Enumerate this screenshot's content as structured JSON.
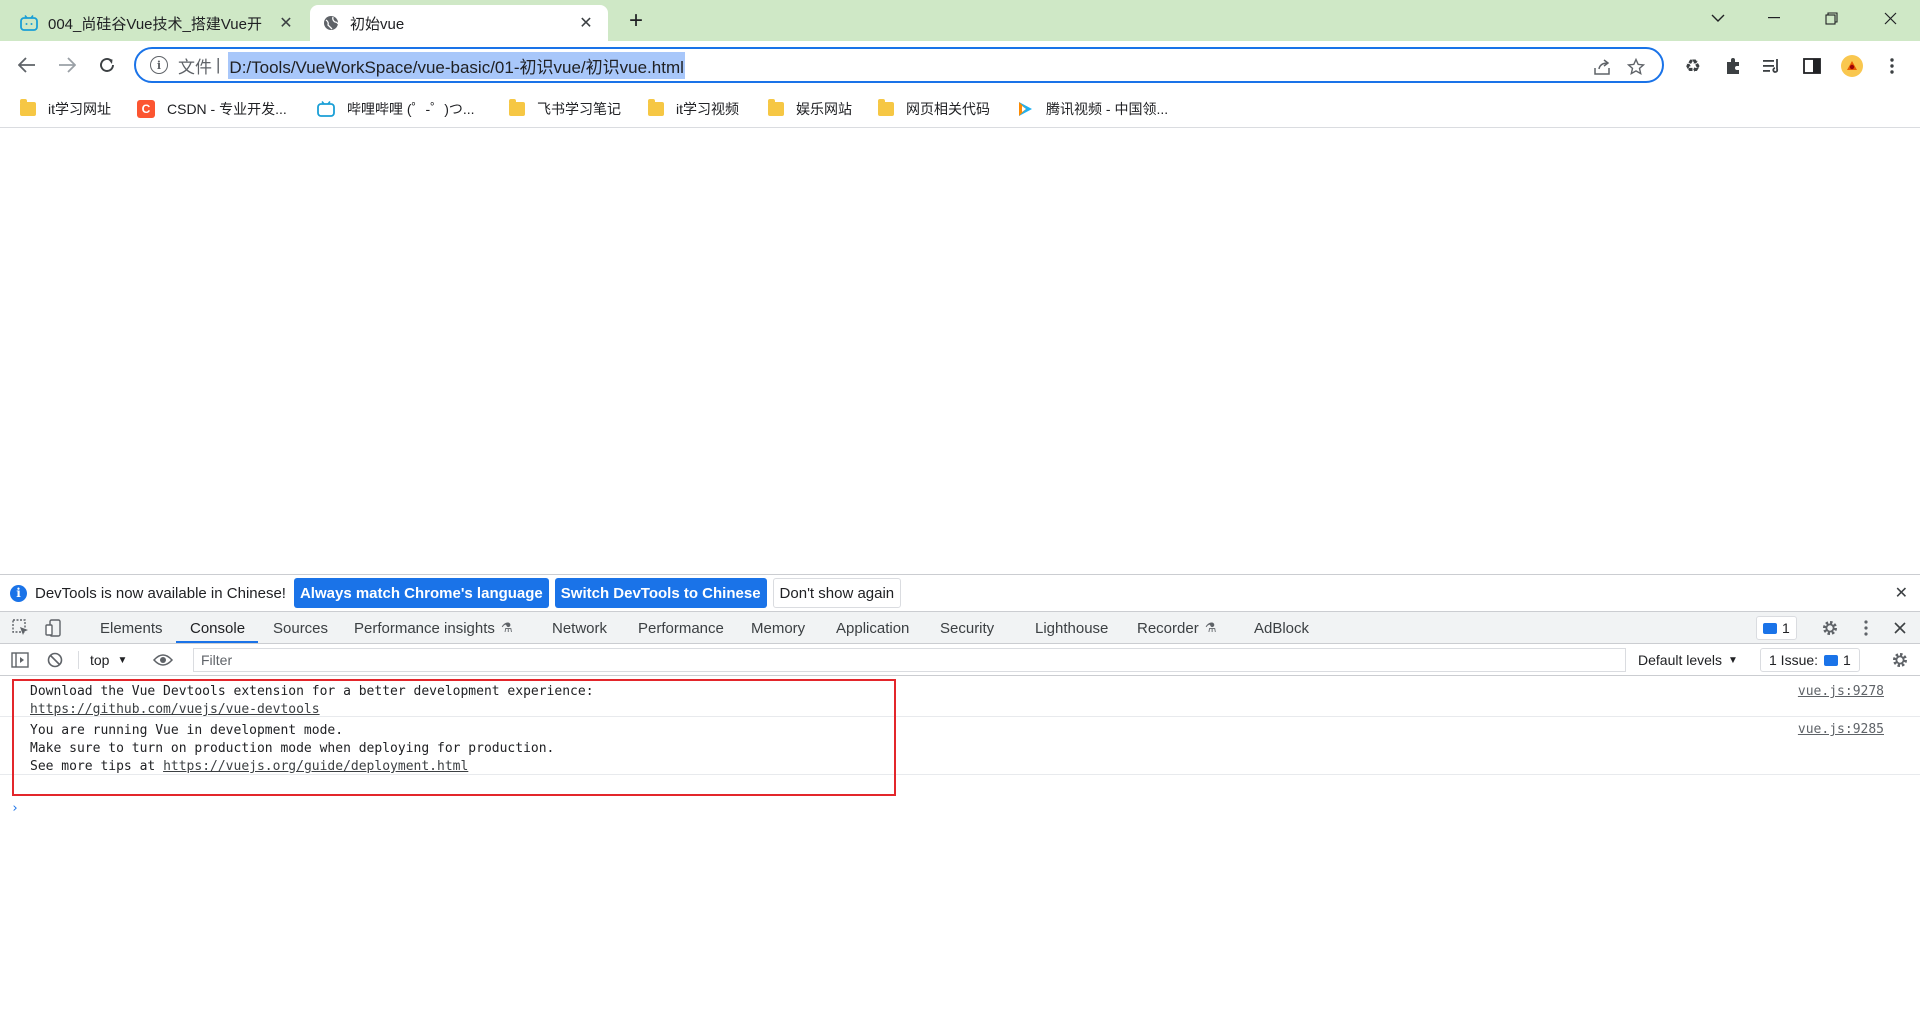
{
  "tabs": [
    {
      "title": "004_尚硅谷Vue技术_搭建Vue开",
      "icon": "bilibili-icon",
      "active": false
    },
    {
      "title": "初始vue",
      "icon": "globe-icon",
      "active": true
    }
  ],
  "toolbar": {
    "url_prefix": "文件",
    "url_separator": "|",
    "url": "D:/Tools/VueWorkSpace/vue-basic/01-初识vue/初识vue.html"
  },
  "bookmarks": [
    {
      "label": "it学习网址",
      "icon": "folder-icon"
    },
    {
      "label": "CSDN - 专业开发...",
      "icon": "csdn-icon",
      "glyph": "C"
    },
    {
      "label": "哔哩哔哩 (゜-゜)つ...",
      "icon": "bilibili-icon"
    },
    {
      "label": "飞书学习笔记",
      "icon": "folder-icon"
    },
    {
      "label": "it学习视频",
      "icon": "folder-icon"
    },
    {
      "label": "娱乐网站",
      "icon": "folder-icon"
    },
    {
      "label": "网页相关代码",
      "icon": "folder-icon"
    },
    {
      "label": "腾讯视频 - 中国领...",
      "icon": "tencent-video-icon"
    }
  ],
  "infobar": {
    "message": "DevTools is now available in Chinese!",
    "btn_match": "Always match Chrome's language",
    "btn_switch": "Switch DevTools to Chinese",
    "btn_dismiss": "Don't show again"
  },
  "devtools": {
    "tabs": [
      "Elements",
      "Console",
      "Sources",
      "Performance insights",
      "Network",
      "Performance",
      "Memory",
      "Application",
      "Security",
      "Lighthouse",
      "Recorder",
      "AdBlock"
    ],
    "active_tab": "Console",
    "message_count": "1"
  },
  "console_toolbar": {
    "context": "top",
    "filter_placeholder": "Filter",
    "levels": "Default levels",
    "issues_label": "1 Issue:",
    "issues_count": "1"
  },
  "console": {
    "messages": [
      {
        "lines": [
          "Download the Vue Devtools extension for a better development experience:"
        ],
        "link": "https://github.com/vuejs/vue-devtools",
        "link_prefix": "",
        "source": "vue.js:9278"
      },
      {
        "lines": [
          "You are running Vue in development mode.",
          "Make sure to turn on production mode when deploying for production."
        ],
        "link_prefix": "See more tips at ",
        "link": "https://vuejs.org/guide/deployment.html",
        "source": "vue.js:9285"
      }
    ],
    "prompt": "›"
  },
  "colors": {
    "tabstrip": "#cfe8c6",
    "accent": "#1a73e8",
    "highlight_box": "#e3262b"
  }
}
